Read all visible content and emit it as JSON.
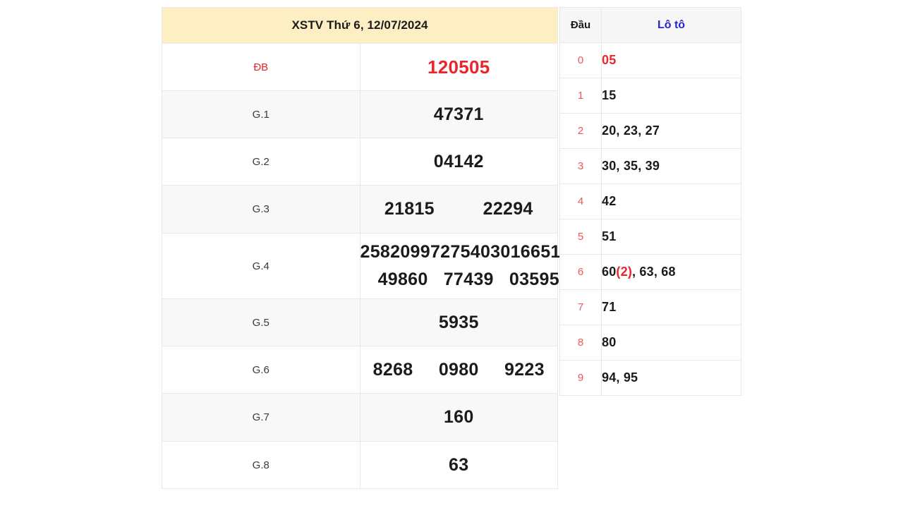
{
  "result_table": {
    "header": "XSTV Thứ 6, 12/07/2024",
    "rows": [
      {
        "label": "ĐB",
        "values": [
          "120505"
        ],
        "highlight": true,
        "shade": false
      },
      {
        "label": "G.1",
        "values": [
          "47371"
        ],
        "highlight": false,
        "shade": true
      },
      {
        "label": "G.2",
        "values": [
          "04142"
        ],
        "highlight": false,
        "shade": false
      },
      {
        "label": "G.3",
        "values": [
          "21815",
          "22294"
        ],
        "highlight": false,
        "shade": true
      },
      {
        "label": "G.4",
        "values": [
          "25820",
          "99727",
          "54030",
          "16651",
          "49860",
          "77439",
          "03595"
        ],
        "highlight": false,
        "shade": false
      },
      {
        "label": "G.5",
        "values": [
          "5935"
        ],
        "highlight": false,
        "shade": true
      },
      {
        "label": "G.6",
        "values": [
          "8268",
          "0980",
          "9223"
        ],
        "highlight": false,
        "shade": false
      },
      {
        "label": "G.7",
        "values": [
          "160"
        ],
        "highlight": false,
        "shade": true
      },
      {
        "label": "G.8",
        "values": [
          "63"
        ],
        "highlight": false,
        "shade": false
      }
    ]
  },
  "loto_table": {
    "header_dau": "Đầu",
    "header_loto": "Lô tô",
    "rows": [
      {
        "dau": "0",
        "loto": "05",
        "red": true
      },
      {
        "dau": "1",
        "loto": "15",
        "red": false
      },
      {
        "dau": "2",
        "loto": "20, 23, 27",
        "red": false
      },
      {
        "dau": "3",
        "loto": "30, 35, 39",
        "red": false
      },
      {
        "dau": "4",
        "loto": "42",
        "red": false
      },
      {
        "dau": "5",
        "loto": "51",
        "red": false
      },
      {
        "dau": "6",
        "loto": "60(2), 63, 68",
        "red": false,
        "dup": "(2)",
        "dup_base": "60",
        "dup_rest": ", 63, 68"
      },
      {
        "dau": "7",
        "loto": "71",
        "red": false
      },
      {
        "dau": "8",
        "loto": "80",
        "red": false
      },
      {
        "dau": "9",
        "loto": "94, 95",
        "red": false
      }
    ]
  },
  "colors": {
    "header_background": "#fdefc3",
    "special_prize_red": "#e8262c",
    "loto_header_blue": "#2424cc",
    "dau_digit_red": "#e8595b",
    "row_shade": "#f8f8f8",
    "border": "#e8e8e8",
    "text_dark": "#1b1b1b"
  }
}
